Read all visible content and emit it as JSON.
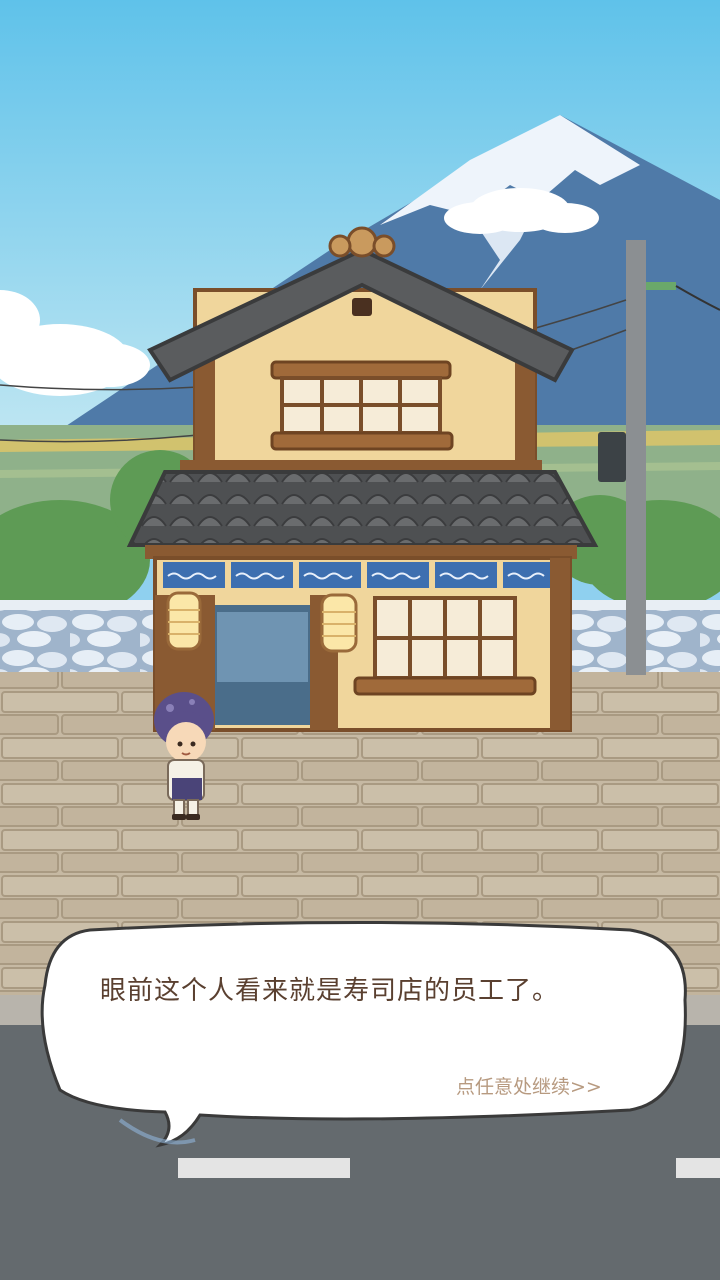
{
  "dialog": {
    "text": "眼前这个人看来就是寿司店的员工了。",
    "continue_hint": "点任意处继续>>"
  },
  "colors": {
    "sky_top": "#5fc2ea",
    "sky_bottom": "#bfe6f2",
    "mountain": "#4f7aa8",
    "snow": "#eef4fb",
    "wall_stone": "#c8bba6",
    "road": "#646a6e",
    "roof": "#5a5c5e",
    "wood": "#8a5a32",
    "noren": "#3d6fb0",
    "dialog_text": "#5a4030",
    "hint_text": "#b79a80"
  },
  "icons": [
    "mountain-icon",
    "sushi-shop-icon",
    "lantern-icon",
    "character-icon",
    "utility-pole-icon",
    "speech-bubble-icon"
  ]
}
